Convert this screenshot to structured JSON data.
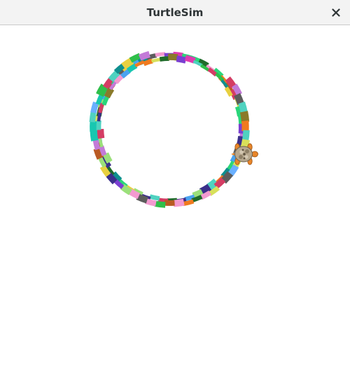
{
  "window": {
    "title": "TurtleSim",
    "close_icon": "close-icon"
  },
  "canvas": {
    "background": "#ffffff",
    "turtle_icon": "turtle-icon"
  }
}
